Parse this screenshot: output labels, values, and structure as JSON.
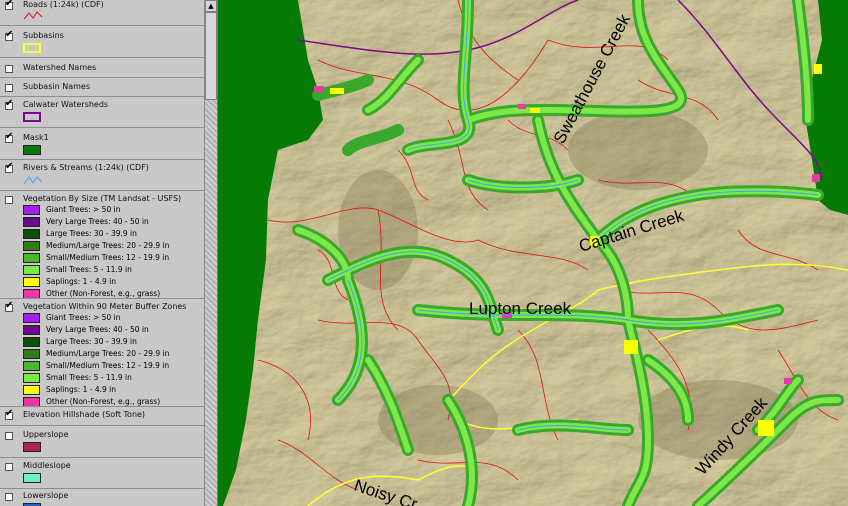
{
  "legend": {
    "layers": [
      {
        "id": "roads",
        "label": "Roads (1:24k) (CDF)",
        "checked": true,
        "symbol": "line-red"
      },
      {
        "id": "subbasins",
        "label": "Subbasins",
        "checked": true,
        "symbol": "box-yellow-outline"
      },
      {
        "id": "watershed-names",
        "label": "Watershed Names",
        "checked": false
      },
      {
        "id": "subbasin-names",
        "label": "Subbasin Names",
        "checked": false
      },
      {
        "id": "calwater",
        "label": "Calwater Watersheds",
        "checked": true,
        "symbol": "box-purple-outline"
      },
      {
        "id": "mask1",
        "label": "Mask1",
        "checked": true,
        "symbol": "box-green-fill"
      },
      {
        "id": "rivers",
        "label": "Rivers & Streams (1:24k) (CDF)",
        "checked": true,
        "symbol": "line-blue"
      },
      {
        "id": "veg-size",
        "label": "Vegetation By Size (TM Landsat - USFS)",
        "checked": false
      },
      {
        "id": "veg-buffer",
        "label": "Vegetation Within 90 Meter Buffer Zones",
        "checked": true
      },
      {
        "id": "hillshade",
        "label": "Elevation Hillshade (Soft Tone)",
        "checked": true
      },
      {
        "id": "upperslope",
        "label": "Upperslope",
        "checked": false,
        "symbol": "box-maroon-fill"
      },
      {
        "id": "middleslope",
        "label": "Middleslope",
        "checked": false,
        "symbol": "box-aqua-fill"
      },
      {
        "id": "lowerslope",
        "label": "Lowerslope",
        "checked": false,
        "symbol": "box-blue-fill"
      }
    ],
    "veg_classes": [
      {
        "label": "Giant Trees: > 50 in",
        "color": "#a020f0"
      },
      {
        "label": "Very Large Trees: 40 - 50 in",
        "color": "#6a0d8a"
      },
      {
        "label": "Large Trees: 30 - 39.9 in",
        "color": "#0b4f0b"
      },
      {
        "label": "Medium/Large Trees: 20 - 29.9 in",
        "color": "#2e7d16"
      },
      {
        "label": "Small/Medium Trees: 12 - 19.9 in",
        "color": "#49b82a"
      },
      {
        "label": "Small Trees: 5 - 11.9 in",
        "color": "#7ee84a"
      },
      {
        "label": "Saplings: 1 - 4.9 in",
        "color": "#ffff00"
      },
      {
        "label": "Other (Non-Forest, e.g., grass)",
        "color": "#e83aa4"
      }
    ],
    "veg_buffer_classes": [
      {
        "label": "Giant Trees: > 50 in",
        "color": "#a020f0"
      },
      {
        "label": "Very Large Trees: 40 - 50 in",
        "color": "#6a0d8a"
      },
      {
        "label": "Large Trees: 30 - 39.9 in",
        "color": "#0b4f0b"
      },
      {
        "label": "Medium/Large Trees: 20 - 29.9 in",
        "color": "#2e7d16"
      },
      {
        "label": "Small/Medium Trees: 12 - 19.9 in",
        "color": "#49b82a"
      },
      {
        "label": "Small Trees: 5 - 11.9 in",
        "color": "#7ee84a"
      },
      {
        "label": "Saplings: 1 - 4.9 in",
        "color": "#ffff00"
      },
      {
        "label": "Other (Non-Forest, e.g., grass)",
        "color": "#e83aa4"
      }
    ]
  },
  "map": {
    "labels": {
      "sweathouse": "Sweathouse Creek",
      "captain": "Captain Creek",
      "lupton": "Lupton Creek",
      "windy": "Windy Creek",
      "noisy": "Noisy Cr"
    },
    "colors": {
      "hillshade": "#c9bf92",
      "mask": "#057a05",
      "roads": "#e01010",
      "subbasin": "#ffff30",
      "calwater": "#7a0a8a",
      "stream": "#40a0ff",
      "buffer_small": "#7ee84a",
      "buffer_medium": "#3aa82a",
      "buffer_large": "#1e6a10",
      "saplings": "#ffff00",
      "other": "#e83aa4"
    }
  }
}
